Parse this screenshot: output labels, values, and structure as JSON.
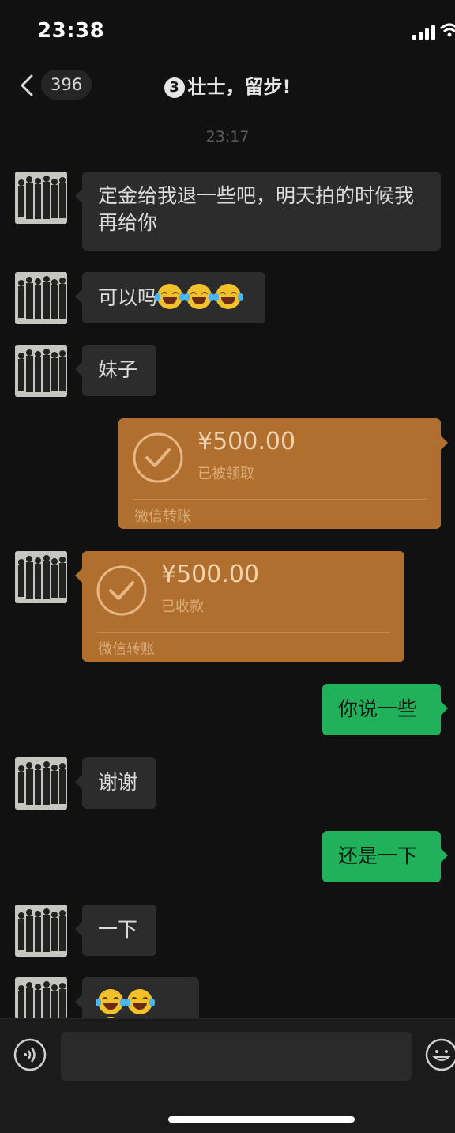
{
  "status_bar": {
    "time": "23:38"
  },
  "header": {
    "unread_count": "396",
    "title_number": "3",
    "title": "壮士，留步!"
  },
  "chat": {
    "timestamp": "23:17",
    "messages": [
      {
        "text": "定金给我退一些吧，明天拍的时候我再给你"
      },
      {
        "text": "可以吗"
      },
      {
        "text": "妹子"
      },
      {
        "amount": "¥500.00",
        "status": "已被领取",
        "label": "微信转账"
      },
      {
        "amount": "¥500.00",
        "status": "已收款",
        "label": "微信转账"
      },
      {
        "text": "你说一些"
      },
      {
        "text": "谢谢"
      },
      {
        "text": "还是一下"
      },
      {
        "text": "一下"
      }
    ]
  },
  "input": {
    "placeholder": ""
  },
  "colors": {
    "sent_bubble": "#21b15b",
    "received_bubble": "#2c2c2c",
    "transfer": "#b06f2e",
    "background": "#111111"
  },
  "icons": [
    "back-icon",
    "signal-icon",
    "wifi-icon",
    "check-icon",
    "laughing-emoji-icon",
    "voice-icon",
    "emoji-icon"
  ]
}
